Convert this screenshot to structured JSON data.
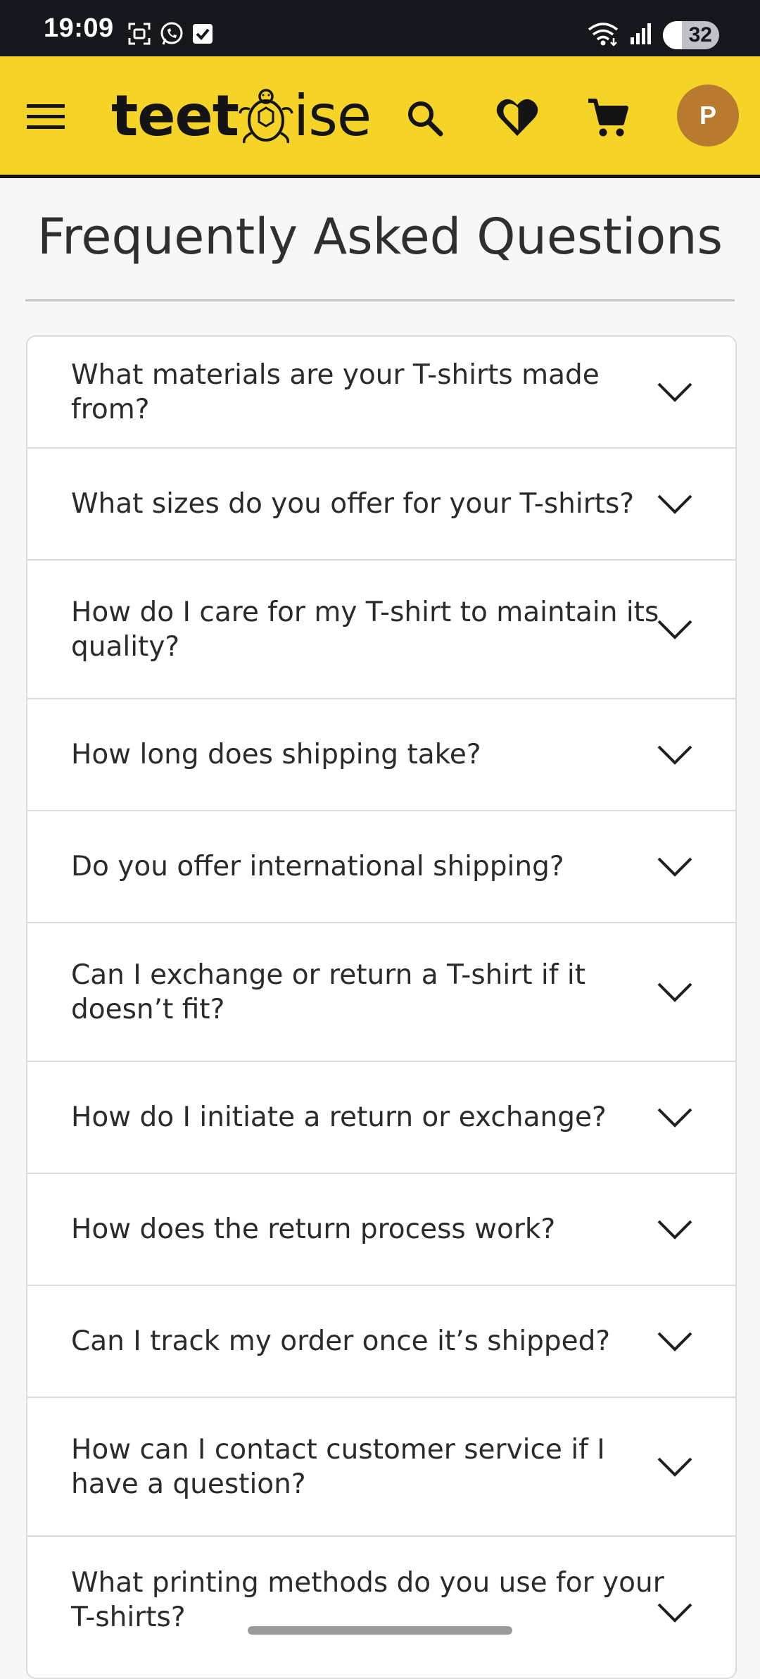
{
  "status_bar": {
    "time": "19:09",
    "battery": "32",
    "icons": [
      "screenshot-icon",
      "whatsapp-icon",
      "checkbox-icon",
      "wifi-icon",
      "signal-icon",
      "battery-icon"
    ]
  },
  "header": {
    "logo_part1": "teet",
    "logo_part2": "ise",
    "avatar_letter": "P",
    "brand_color": "#f5d327",
    "avatar_color": "#b87a2e",
    "icons": [
      "menu-icon",
      "search-icon",
      "heart-icon",
      "cart-icon"
    ]
  },
  "page": {
    "title": "Frequently Asked Questions"
  },
  "faq": {
    "items": [
      {
        "question": "What materials are your T-shirts made from?"
      },
      {
        "question": "What sizes do you offer for your T-shirts?"
      },
      {
        "question": "How do I care for my T-shirt to maintain its quality?"
      },
      {
        "question": "How long does shipping take?"
      },
      {
        "question": "Do you offer international shipping?"
      },
      {
        "question": "Can I exchange or return a T-shirt if it doesn’t fit?"
      },
      {
        "question": "How do I initiate a return or exchange?"
      },
      {
        "question": "How does the return process work?"
      },
      {
        "question": "Can I track my order once it’s shipped?"
      },
      {
        "question": "How can I contact customer service if I have a question?"
      },
      {
        "question": "What printing methods do you use for your T-shirts?"
      }
    ]
  }
}
